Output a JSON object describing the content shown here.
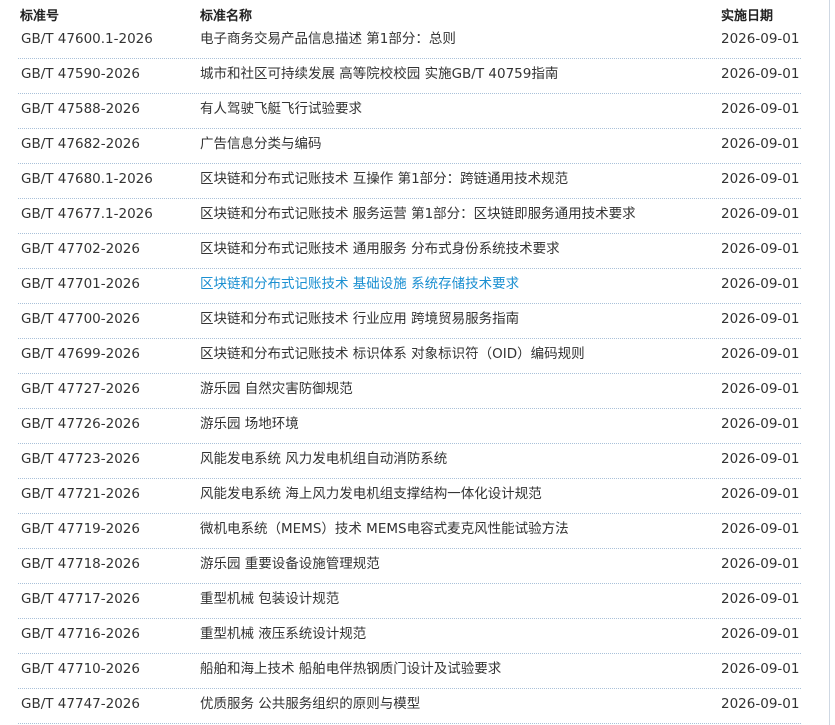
{
  "table": {
    "headers": {
      "code": "标准号",
      "name": "标准名称",
      "date": "实施日期"
    },
    "rows": [
      {
        "code": "GB/T 47600.1-2026",
        "name": "电子商务交易产品信息描述 第1部分：总则",
        "date": "2026-09-01"
      },
      {
        "code": "GB/T 47590-2026",
        "name": "城市和社区可持续发展 高等院校校园 实施GB/T 40759指南",
        "date": "2026-09-01"
      },
      {
        "code": "GB/T 47588-2026",
        "name": "有人驾驶飞艇飞行试验要求",
        "date": "2026-09-01"
      },
      {
        "code": "GB/T 47682-2026",
        "name": "广告信息分类与编码",
        "date": "2026-09-01"
      },
      {
        "code": "GB/T 47680.1-2026",
        "name": "区块链和分布式记账技术 互操作 第1部分：跨链通用技术规范",
        "date": "2026-09-01"
      },
      {
        "code": "GB/T 47677.1-2026",
        "name": "区块链和分布式记账技术 服务运营 第1部分：区块链即服务通用技术要求",
        "date": "2026-09-01"
      },
      {
        "code": "GB/T 47702-2026",
        "name": "区块链和分布式记账技术 通用服务 分布式身份系统技术要求",
        "date": "2026-09-01"
      },
      {
        "code": "GB/T 47701-2026",
        "name": "区块链和分布式记账技术 基础设施 系统存储技术要求",
        "date": "2026-09-01"
      },
      {
        "code": "GB/T 47700-2026",
        "name": "区块链和分布式记账技术 行业应用 跨境贸易服务指南",
        "date": "2026-09-01"
      },
      {
        "code": "GB/T 47699-2026",
        "name": "区块链和分布式记账技术 标识体系 对象标识符（OID）编码规则",
        "date": "2026-09-01"
      },
      {
        "code": "GB/T 47727-2026",
        "name": "游乐园 自然灾害防御规范",
        "date": "2026-09-01"
      },
      {
        "code": "GB/T 47726-2026",
        "name": "游乐园 场地环境",
        "date": "2026-09-01"
      },
      {
        "code": "GB/T 47723-2026",
        "name": "风能发电系统 风力发电机组自动消防系统",
        "date": "2026-09-01"
      },
      {
        "code": "GB/T 47721-2026",
        "name": "风能发电系统 海上风力发电机组支撑结构一体化设计规范",
        "date": "2026-09-01"
      },
      {
        "code": "GB/T 47719-2026",
        "name": "微机电系统（MEMS）技术 MEMS电容式麦克风性能试验方法",
        "date": "2026-09-01"
      },
      {
        "code": "GB/T 47718-2026",
        "name": "游乐园 重要设备设施管理规范",
        "date": "2026-09-01"
      },
      {
        "code": "GB/T 47717-2026",
        "name": "重型机械 包装设计规范",
        "date": "2026-09-01"
      },
      {
        "code": "GB/T 47716-2026",
        "name": "重型机械 液压系统设计规范",
        "date": "2026-09-01"
      },
      {
        "code": "GB/T 47710-2026",
        "name": "船舶和海上技术 船舶电伴热钢质门设计及试验要求",
        "date": "2026-09-01"
      },
      {
        "code": "GB/T 47747-2026",
        "name": "优质服务 公共服务组织的原则与模型",
        "date": "2026-09-01"
      }
    ],
    "hovered_row_index": 7,
    "colors": {
      "text": "#333333",
      "link_hover": "#1a8fd1",
      "row_divider": "#a9c1d9",
      "frame_border": "#cfd8e3"
    }
  }
}
